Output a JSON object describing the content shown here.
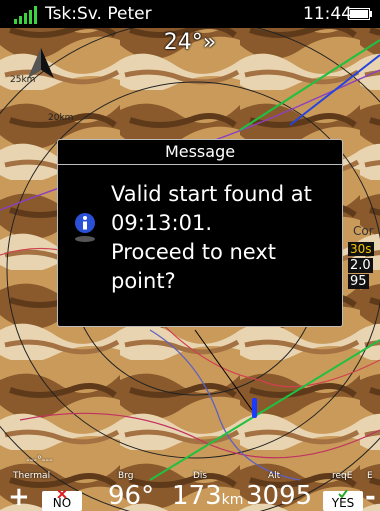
{
  "status_bar": {
    "task": "Tsk:Sv. Peter",
    "time": "11:44"
  },
  "map": {
    "heading": "24°»",
    "range_labels": [
      "25km",
      "20km"
    ],
    "side_labels": {
      "top": "Cor",
      "time": "30s",
      "mid": "2.0",
      "bottom": "95"
    },
    "wind_label": "---°---"
  },
  "dialog": {
    "title": "Message",
    "lines": [
      "Valid start found at",
      "09:13:01.",
      "Proceed to next",
      "point?"
    ]
  },
  "bottom_bar": {
    "labels": {
      "thermal": "Thermal",
      "brg": "Brg",
      "dis": "Dis",
      "alt": "Alt",
      "reqe": "reqE",
      "e": "E"
    },
    "zoom_in": "+",
    "zoom_out": "-",
    "no": "NO",
    "yes": "YES",
    "brg_value": "96°",
    "dis_value": "173",
    "dis_unit": "km",
    "alt_value": "3095"
  },
  "colors": {
    "signal": "#3cd43c",
    "dialog_border": "#bdbdbd",
    "no_icon": "#d81e1e",
    "yes_icon": "#2aa82a"
  }
}
